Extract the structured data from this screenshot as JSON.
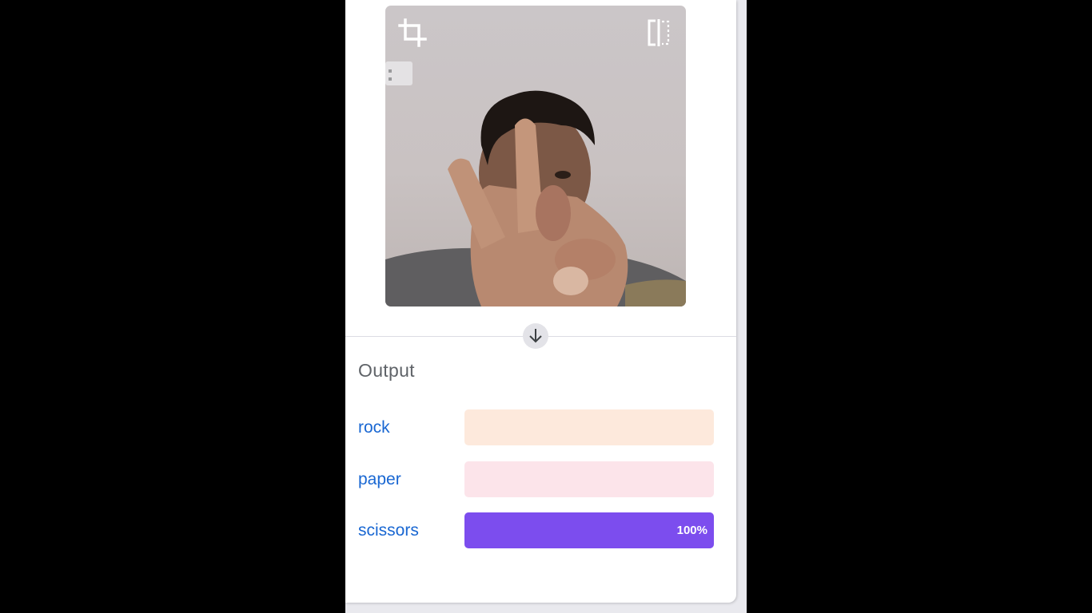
{
  "preview": {
    "crop_icon": "crop-icon",
    "flip_icon": "flip-horizontal-icon"
  },
  "divider_icon": "arrow-down-icon",
  "output": {
    "title": "Output",
    "classes": [
      {
        "label": "rock",
        "percent": 0,
        "percent_label": "",
        "track_color": "#fde9dc",
        "fill_color": "#f97316"
      },
      {
        "label": "paper",
        "percent": 0,
        "percent_label": "",
        "track_color": "#fce4ea",
        "fill_color": "#ec4899"
      },
      {
        "label": "scissors",
        "percent": 100,
        "percent_label": "100%",
        "track_color": "#ede4fd",
        "fill_color": "#7c4dee"
      }
    ]
  },
  "colors": {
    "label_blue": "#1967d2",
    "title_gray": "#5f6368"
  }
}
